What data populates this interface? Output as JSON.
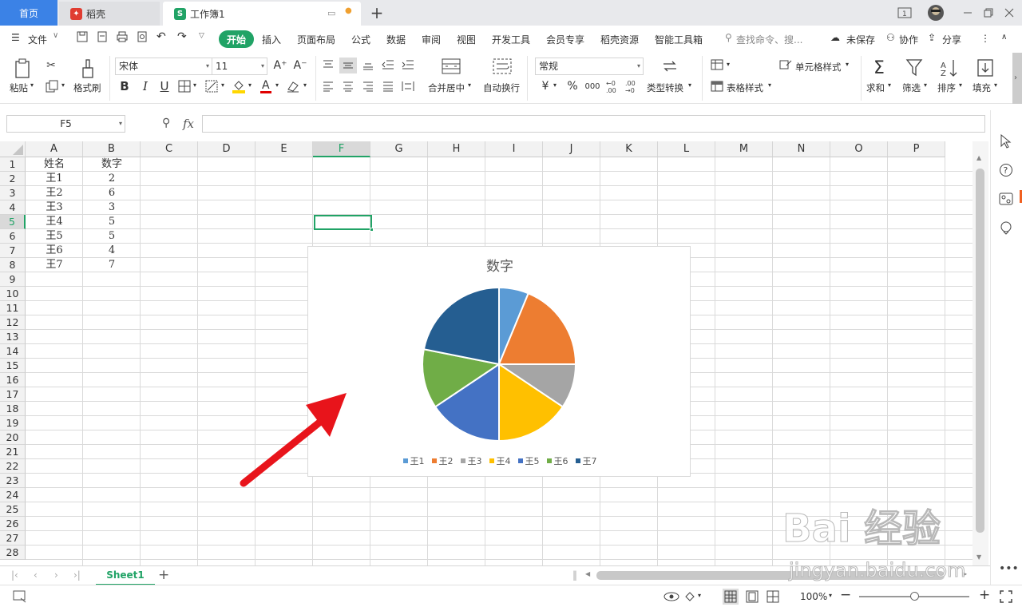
{
  "titlebar": {
    "home_tab": "首页",
    "docer_tab": "稻壳",
    "workbook_tab": "工作簿1",
    "new_tab": "+"
  },
  "menubar": {
    "file": "文件",
    "items": [
      "开始",
      "插入",
      "页面布局",
      "公式",
      "数据",
      "审阅",
      "视图",
      "开发工具",
      "会员专享",
      "稻壳资源",
      "智能工具箱"
    ],
    "search_placeholder": "查找命令、搜...",
    "unsaved": "未保存",
    "collab": "协作",
    "share": "分享"
  },
  "ribbon": {
    "paste": "粘贴",
    "format_painter": "格式刷",
    "font_name": "宋体",
    "font_size": "11",
    "merge_center": "合并居中",
    "wrap_text": "自动换行",
    "number_format": "常规",
    "type_convert": "类型转换",
    "cell_style": "单元格样式",
    "table_style": "表格样式",
    "sum": "求和",
    "filter": "筛选",
    "sort": "排序",
    "fill": "填充",
    "bold": "B",
    "italic": "I",
    "underline": "U",
    "percent": "%",
    "thousands": "000",
    "currency": "¥"
  },
  "formula_bar": {
    "name_box": "F5",
    "fx": "fx",
    "value": ""
  },
  "columns": [
    "A",
    "B",
    "C",
    "D",
    "E",
    "F",
    "G",
    "H",
    "I",
    "J",
    "K",
    "L",
    "M",
    "N",
    "O",
    "P"
  ],
  "rows": [
    "1",
    "2",
    "3",
    "4",
    "5",
    "6",
    "7",
    "8",
    "9",
    "10",
    "11",
    "12",
    "13",
    "14",
    "15",
    "16",
    "17",
    "18",
    "19",
    "20",
    "21",
    "22",
    "23",
    "24",
    "25",
    "26",
    "27",
    "28"
  ],
  "sheet_cells": {
    "header": [
      "姓名",
      "数字"
    ],
    "data": [
      [
        "王1",
        "2"
      ],
      [
        "王2",
        "6"
      ],
      [
        "王3",
        "3"
      ],
      [
        "王4",
        "5"
      ],
      [
        "王5",
        "5"
      ],
      [
        "王6",
        "4"
      ],
      [
        "王7",
        "7"
      ]
    ]
  },
  "chart_data": {
    "type": "pie",
    "title": "数字",
    "categories": [
      "王1",
      "王2",
      "王3",
      "王4",
      "王5",
      "王6",
      "王7"
    ],
    "values": [
      2,
      6,
      3,
      5,
      5,
      4,
      7
    ],
    "colors": [
      "#5b9bd5",
      "#ed7d31",
      "#a5a5a5",
      "#ffc000",
      "#4472c4",
      "#70ad47",
      "#255e91"
    ],
    "legend": "bottom"
  },
  "sheet_tabs": {
    "active": "Sheet1",
    "add": "+"
  },
  "statusbar": {
    "zoom": "100%"
  },
  "colors": {
    "accent_green": "#21a366",
    "home_tab_blue": "#3b82e6",
    "arrow_red": "#e8141b"
  },
  "watermark": {
    "brand": "Bai 经验",
    "url": "jingyan.baidu.com"
  }
}
